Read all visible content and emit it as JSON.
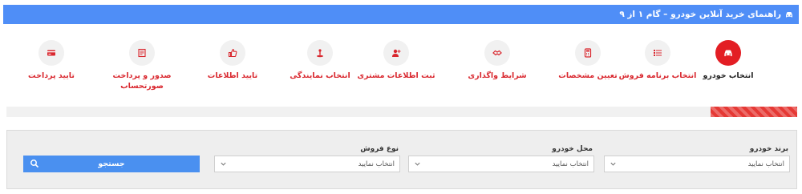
{
  "header": {
    "title": "راهنمای خرید آنلاین خودرو – گام ۱ از ۹",
    "icon": "car-icon"
  },
  "steps": [
    {
      "label": "انتخاب خودرو",
      "icon": "car-icon",
      "active": true
    },
    {
      "label": "انتخاب برنامه فروش",
      "icon": "list-icon",
      "active": false
    },
    {
      "label": "تعیین مشخصات",
      "icon": "calculator-icon",
      "active": false
    },
    {
      "label": "شرایط واگذاری",
      "icon": "handshake-icon",
      "active": false
    },
    {
      "label": "ثبت اطلاعات مشتری",
      "icon": "user-plus-icon",
      "active": false
    },
    {
      "label": "انتخاب نمایندگی",
      "icon": "location-icon",
      "active": false
    },
    {
      "label": "تایید اطلاعات",
      "icon": "thumbs-up-icon",
      "active": false
    },
    {
      "label": "صدور و پرداخت صورتحساب",
      "icon": "invoice-icon",
      "active": false
    },
    {
      "label": "تایید پرداخت",
      "icon": "credit-card-icon",
      "active": false
    }
  ],
  "progress": {
    "fraction": 0.11
  },
  "filters": {
    "brand": {
      "label": "برند خودرو",
      "placeholder": "انتخاب نمایید"
    },
    "location": {
      "label": "محل خودرو",
      "placeholder": "انتخاب نمایید"
    },
    "sale_type": {
      "label": "نوع فروش",
      "placeholder": "انتخاب نمایید"
    }
  },
  "search": {
    "label": "جستجو",
    "icon": "search-icon"
  },
  "colors": {
    "header": "#4f8ef7",
    "accent": "#e31e24",
    "button": "#4a90f0"
  }
}
